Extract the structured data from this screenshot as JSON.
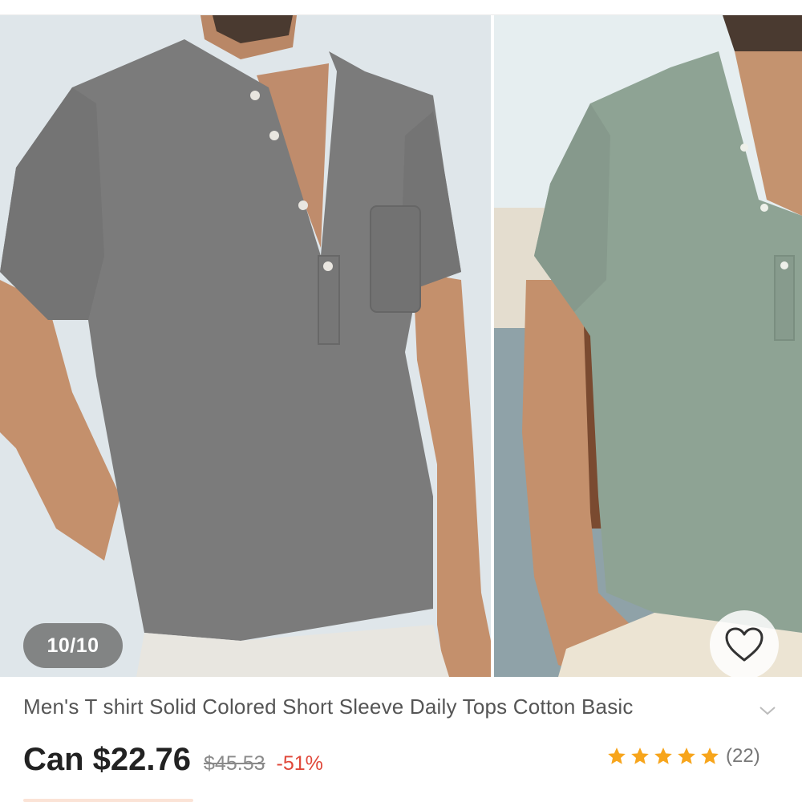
{
  "gallery": {
    "counter": "10/10",
    "favorite_icon": "heart-outline-icon",
    "shirt_colors": [
      "#7b7b7b",
      "#8ea394"
    ]
  },
  "product": {
    "title": "Men's T shirt Solid Colored Short Sleeve Daily Tops Cotton Basic",
    "expand_icon": "chevron-down-icon"
  },
  "pricing": {
    "price": "Can $22.76",
    "original_price": "$45.53",
    "discount": "-51%",
    "discount_color": "#e0483a"
  },
  "rating": {
    "stars": 5,
    "star_color": "#f7a51c",
    "count": "(22)"
  }
}
